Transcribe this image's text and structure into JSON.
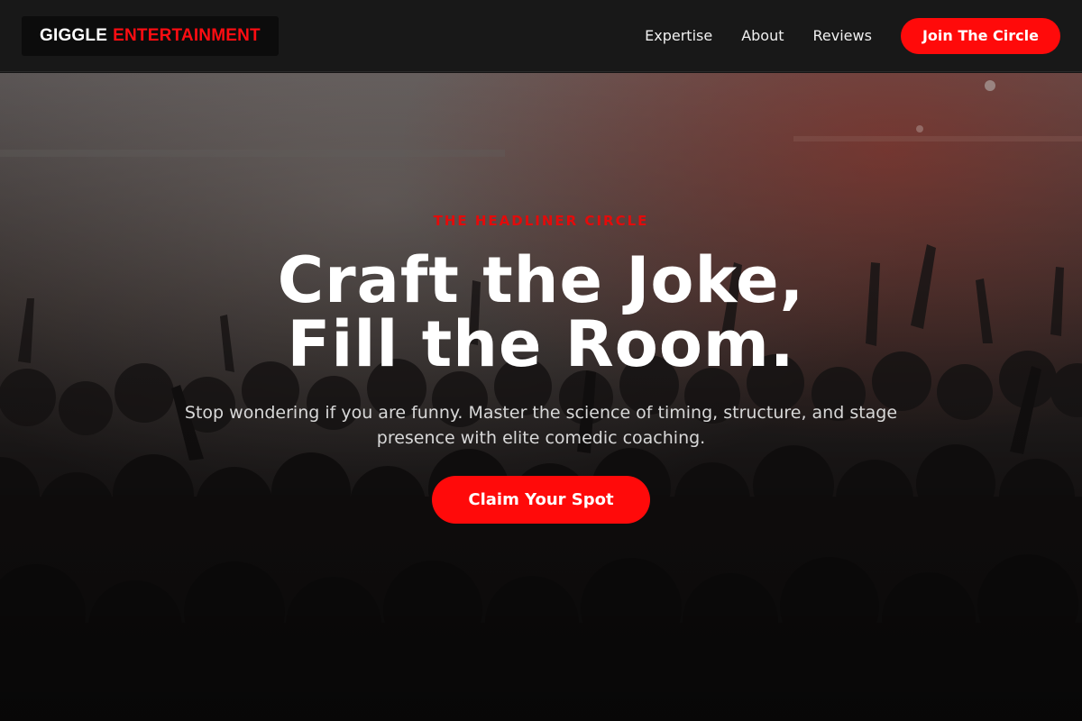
{
  "brand": {
    "word1": "GIGGLE",
    "word2": "ENTERTAINMENT"
  },
  "nav": {
    "links": [
      "Expertise",
      "About",
      "Reviews"
    ],
    "cta": "Join The Circle"
  },
  "hero": {
    "eyebrow": "THE HEADLINER CIRCLE",
    "headline_line1": "Craft the Joke,",
    "headline_line2": "Fill the Room.",
    "subtitle": "Stop wondering if you are funny. Master the science of timing, structure, and stage presence with elite comedic coaching.",
    "cta": "Claim Your Spot",
    "background": "concert-crowd-photo"
  },
  "colors": {
    "accent": "#ff0a0a",
    "nav_bg": "#181818",
    "page_bg": "#141414"
  }
}
